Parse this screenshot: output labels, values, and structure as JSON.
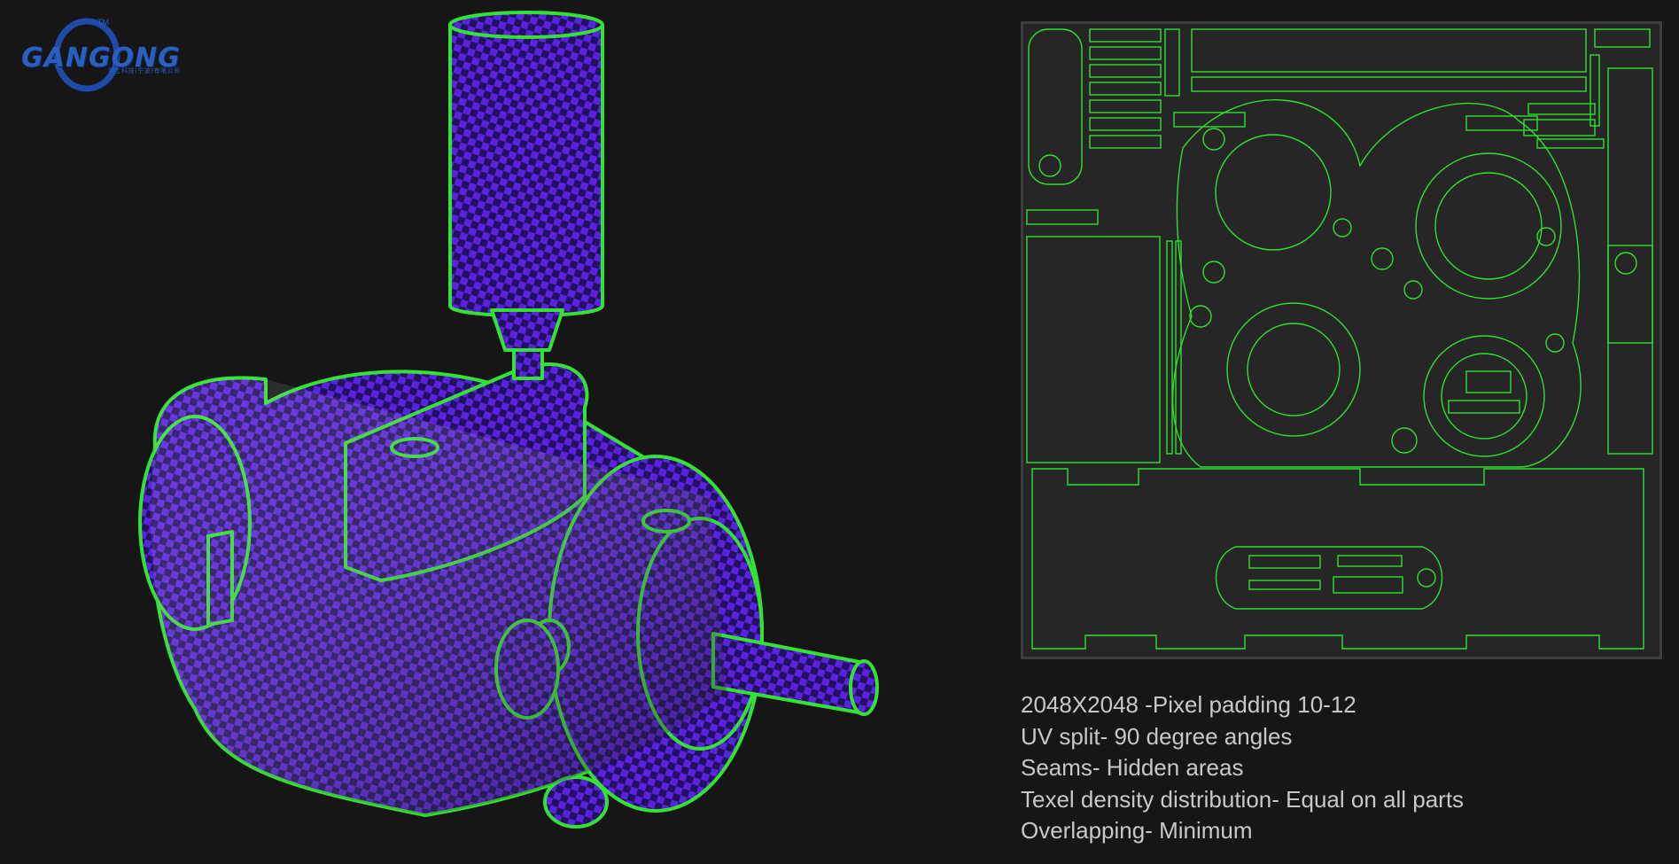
{
  "logo": {
    "name": "GANGONG",
    "trademark": "TM",
    "subtitle": "钢工科技(宁波)有限公司"
  },
  "colors": {
    "background": "#161616",
    "uv_seam": "#2fe02f",
    "checker_a": "#6a2ef0",
    "checker_b": "#1a0a4a",
    "uv_background": "#262626"
  },
  "notes": [
    "2048X2048 -Pixel padding 10-12",
    "UV split- 90 degree angles",
    "Seams- Hidden areas",
    "Texel density distribution- Equal on all parts",
    "Overlapping- Minimum"
  ]
}
